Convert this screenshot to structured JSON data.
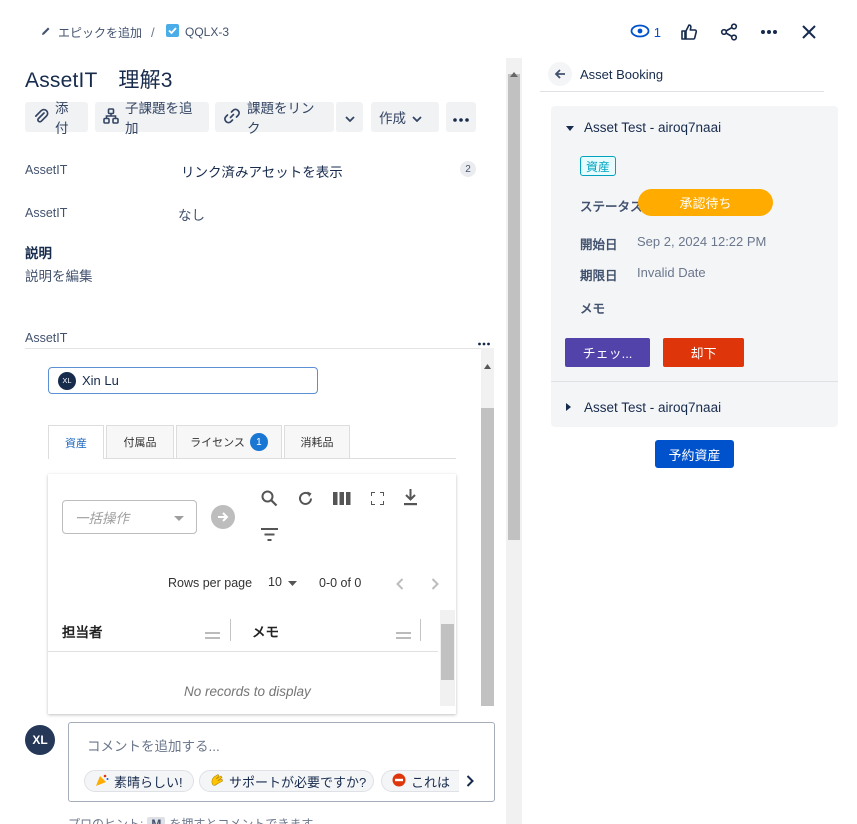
{
  "breadcrumb": {
    "epic_label": "エピックを追加",
    "separator": "/",
    "issue_key": "QQLX-3"
  },
  "top_actions": {
    "watch_count": "1"
  },
  "issue": {
    "title": "AssetIT　理解3"
  },
  "toolbar": {
    "attach": "添付",
    "add_subtask": "子課題を追加",
    "link_issue": "課題をリンク",
    "create": "作成"
  },
  "fields": [
    {
      "label": "AssetIT",
      "value": "リンク済みアセットを表示",
      "count": "2"
    },
    {
      "label": "AssetIT",
      "value": "なし"
    }
  ],
  "description": {
    "heading": "説明",
    "placeholder": "説明を編集"
  },
  "asset_section": {
    "label": "AssetIT",
    "user_initials": "XL",
    "user_name": "Xin Lu",
    "tabs": [
      {
        "label": "資産",
        "active": true
      },
      {
        "label": "付属品"
      },
      {
        "label": "ライセンス",
        "badge": "1"
      },
      {
        "label": "消耗品"
      }
    ],
    "bulk_placeholder": "一括操作",
    "rows_per_page_label": "Rows per page",
    "rows_per_page_value": "10",
    "range": "0-0 of 0",
    "columns": [
      "担当者",
      "メモ"
    ],
    "empty_text": "No records to display"
  },
  "comment": {
    "avatar_initials": "XL",
    "placeholder": "コメントを追加する...",
    "chips": [
      "素晴らしい!",
      "サポートが必要ですか?",
      "これは"
    ],
    "hint_prefix": "プロのヒント:",
    "hint_key": "M",
    "hint_suffix": "を押すとコメントできます"
  },
  "booking": {
    "title": "Asset Booking",
    "item1": {
      "name": "Asset Test - airoq7naai",
      "tag": "資産",
      "status_label": "ステータス",
      "status_value": "承認待ち",
      "start_label": "開始日",
      "start_value": "Sep 2, 2024 12:22 PM",
      "due_label": "期限日",
      "due_value": "Invalid Date",
      "memo_label": "メモ",
      "checkout_button": "チェッ...",
      "reject_button": "却下"
    },
    "item2": {
      "name": "Asset Test - airoq7naai"
    },
    "reserve_button": "予約資産"
  },
  "colors": {
    "status": "#ffab00",
    "checkout": "#5243aa",
    "reject": "#de350b",
    "reserve": "#0052cc",
    "tag": "#00a3bf",
    "link": "#1565c0"
  }
}
